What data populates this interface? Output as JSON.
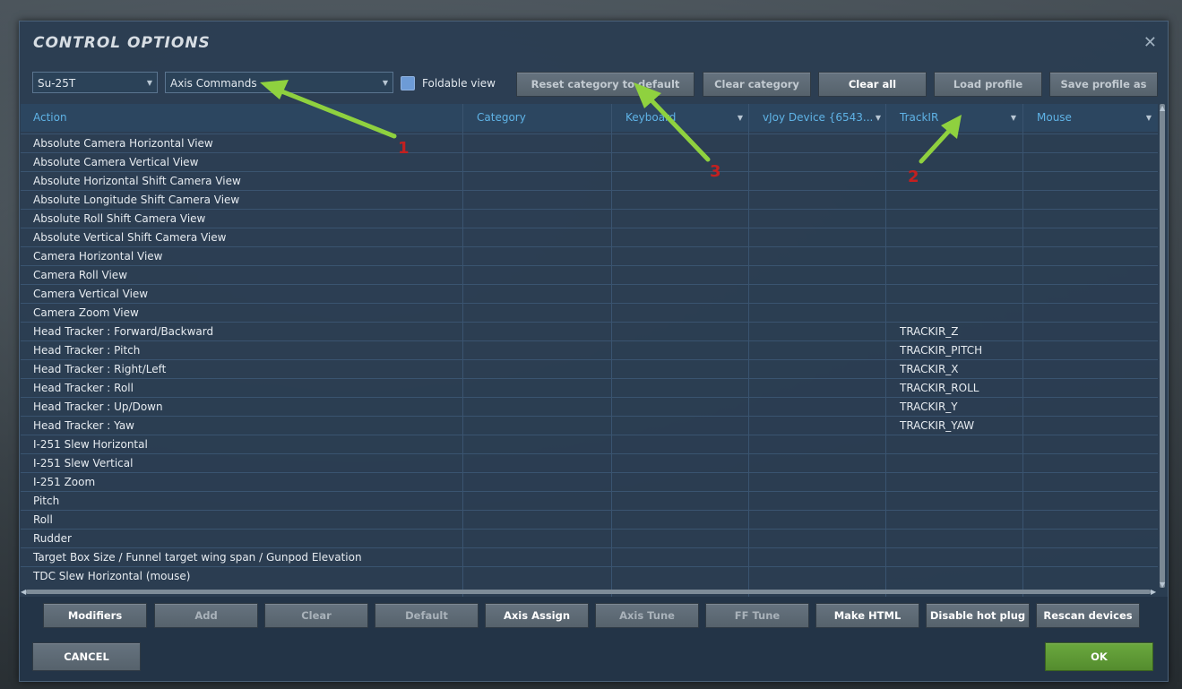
{
  "dialog": {
    "title": "CONTROL OPTIONS",
    "close_glyph": "✕"
  },
  "toolbar": {
    "aircraft": "Su-25T",
    "category": "Axis Commands",
    "foldable_label": "Foldable view",
    "buttons": [
      "Reset category to default",
      "Clear category",
      "Clear all",
      "Load profile",
      "Save profile as"
    ]
  },
  "table": {
    "columns": [
      "Action",
      "Category",
      "Keyboard",
      "vJoy Device {6543...",
      "TrackIR",
      "Mouse"
    ],
    "rows": [
      {
        "action": "Absolute Camera Horizontal View",
        "trackir": ""
      },
      {
        "action": "Absolute Camera Vertical View",
        "trackir": ""
      },
      {
        "action": "Absolute Horizontal Shift Camera View",
        "trackir": ""
      },
      {
        "action": "Absolute Longitude Shift Camera View",
        "trackir": ""
      },
      {
        "action": "Absolute Roll Shift Camera View",
        "trackir": ""
      },
      {
        "action": "Absolute Vertical Shift Camera View",
        "trackir": ""
      },
      {
        "action": "Camera Horizontal View",
        "trackir": ""
      },
      {
        "action": "Camera Roll View",
        "trackir": ""
      },
      {
        "action": "Camera Vertical View",
        "trackir": ""
      },
      {
        "action": "Camera Zoom View",
        "trackir": ""
      },
      {
        "action": "Head Tracker : Forward/Backward",
        "trackir": "TRACKIR_Z"
      },
      {
        "action": "Head Tracker : Pitch",
        "trackir": "TRACKIR_PITCH"
      },
      {
        "action": "Head Tracker : Right/Left",
        "trackir": "TRACKIR_X"
      },
      {
        "action": "Head Tracker : Roll",
        "trackir": "TRACKIR_ROLL"
      },
      {
        "action": "Head Tracker : Up/Down",
        "trackir": "TRACKIR_Y"
      },
      {
        "action": "Head Tracker : Yaw",
        "trackir": "TRACKIR_YAW"
      },
      {
        "action": "I-251 Slew Horizontal",
        "trackir": ""
      },
      {
        "action": "I-251 Slew Vertical",
        "trackir": ""
      },
      {
        "action": "I-251 Zoom",
        "trackir": ""
      },
      {
        "action": "Pitch",
        "trackir": ""
      },
      {
        "action": "Roll",
        "trackir": ""
      },
      {
        "action": "Rudder",
        "trackir": ""
      },
      {
        "action": "Target Box Size / Funnel target wing span / Gunpod Elevation",
        "trackir": ""
      },
      {
        "action": "TDC Slew Horizontal (mouse)",
        "trackir": ""
      }
    ]
  },
  "bottom_buttons": [
    "Modifiers",
    "Add",
    "Clear",
    "Default",
    "Axis Assign",
    "Axis Tune",
    "FF Tune",
    "Make HTML",
    "Disable hot plug",
    "Rescan devices"
  ],
  "footer": {
    "cancel": "CANCEL",
    "ok": "OK"
  },
  "annotations": [
    "1",
    "2",
    "3"
  ],
  "colors": {
    "ok_button": "#5c9a34",
    "header_text": "#5fb3e6",
    "arrow": "#8fd13f",
    "annotation": "#c32020"
  }
}
